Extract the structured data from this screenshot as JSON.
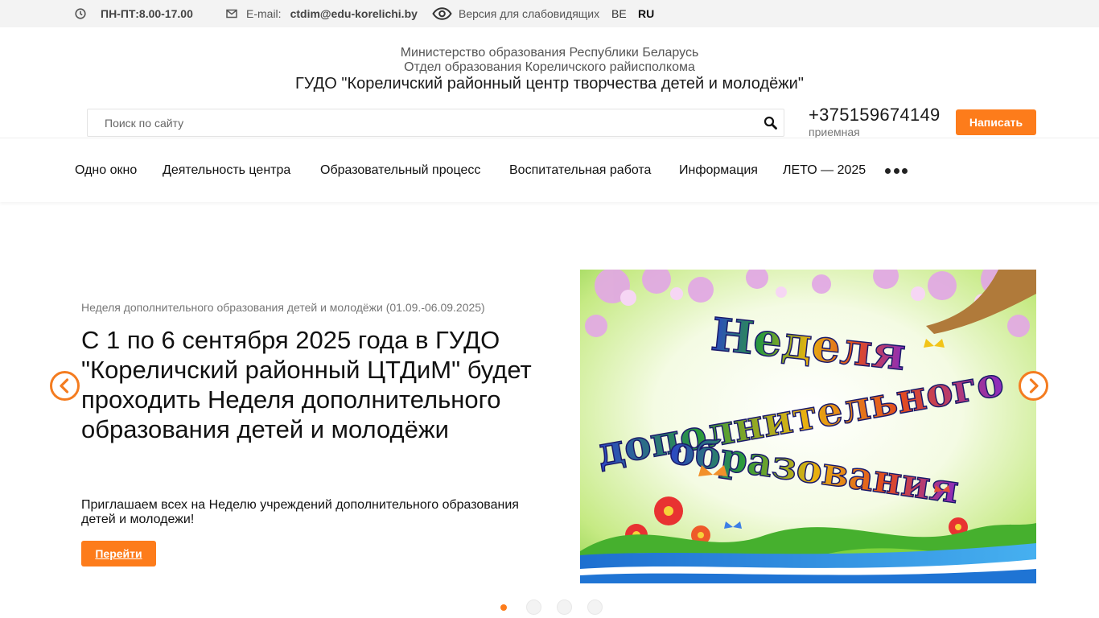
{
  "topbar": {
    "hours": "ПН-ПТ:8.00-17.00",
    "email_label": "E-mail:",
    "email": "ctdim@edu-korelichi.by",
    "accessibility": "Версия для слабовидящих",
    "lang_be": "BE",
    "lang_ru": "RU",
    "icons": {
      "clock": "clock-icon",
      "mail": "mail-icon",
      "eye": "eye-icon"
    }
  },
  "header": {
    "line1": "Министерство образования Республики Беларусь",
    "line2": "Отдел образования Кореличского райисполкома",
    "title": "ГУДО \"Кореличский районный центр творчества детей и молодёжи\"",
    "search_placeholder": "Поиск по сайту",
    "phone": "+375159674149",
    "phone_caption": "приемная",
    "write_button": "Написать"
  },
  "nav": {
    "items": [
      "Одно окно",
      "Деятельность центра",
      "Образовательный процесс",
      "Воспитательная работа",
      "Информация",
      "ЛЕТО — 2025"
    ]
  },
  "slider": {
    "category": "Неделя дополнительного образования детей и молодёжи (01.09.-06.09.2025)",
    "title": "С 1 по 6 сентября 2025 года в ГУДО \"Кореличский районный ЦТДиМ\" будет проходить Неделя дополнительного образования детей и молодёжи",
    "text": "Приглашаем всех на Неделю учреждений дополнительного образования детей и молодежи!",
    "button": "Перейти",
    "image_caption_lines": [
      "Неделя",
      "дополнительного",
      "образования"
    ],
    "slide_count": 4,
    "active_slide": 1
  },
  "colors": {
    "accent": "#fd7c1b",
    "arrow": "#f47c20",
    "topbar_bg": "#f3f3f3"
  }
}
